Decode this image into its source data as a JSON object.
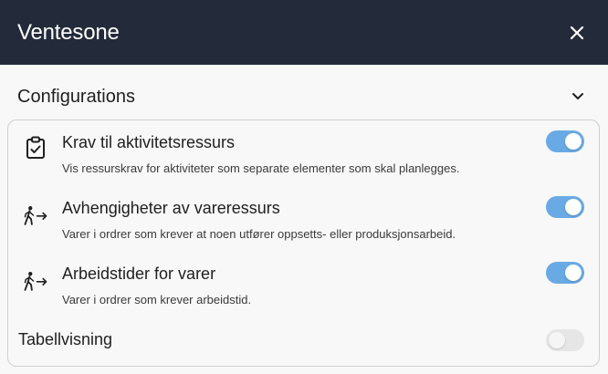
{
  "header": {
    "title": "Ventesone",
    "close_icon": "close-icon"
  },
  "section": {
    "title": "Configurations",
    "chevron_icon": "chevron-down-icon"
  },
  "items": [
    {
      "title": "Krav til aktivitetsressurs",
      "description": "Vis ressurskrav for aktiviteter som separate elementer som skal planlegges.",
      "icon": "clipboard-check-icon",
      "enabled": true
    },
    {
      "title": "Avhengigheter av vareressurs",
      "description": "Varer i ordrer som krever at noen utfører oppsetts- eller produksjonsarbeid.",
      "icon": "walking-person-arrow-icon",
      "enabled": true
    },
    {
      "title": "Arbeidstider for varer",
      "description": "Varer i ordrer som krever arbeidstid.",
      "icon": "walking-person-arrow-icon",
      "enabled": true
    }
  ],
  "table_view": {
    "label": "Tabellvisning",
    "enabled": false
  },
  "colors": {
    "header_bg": "#232b3a",
    "toggle_on": "#6aaae4",
    "toggle_off": "#e6e6e6"
  }
}
